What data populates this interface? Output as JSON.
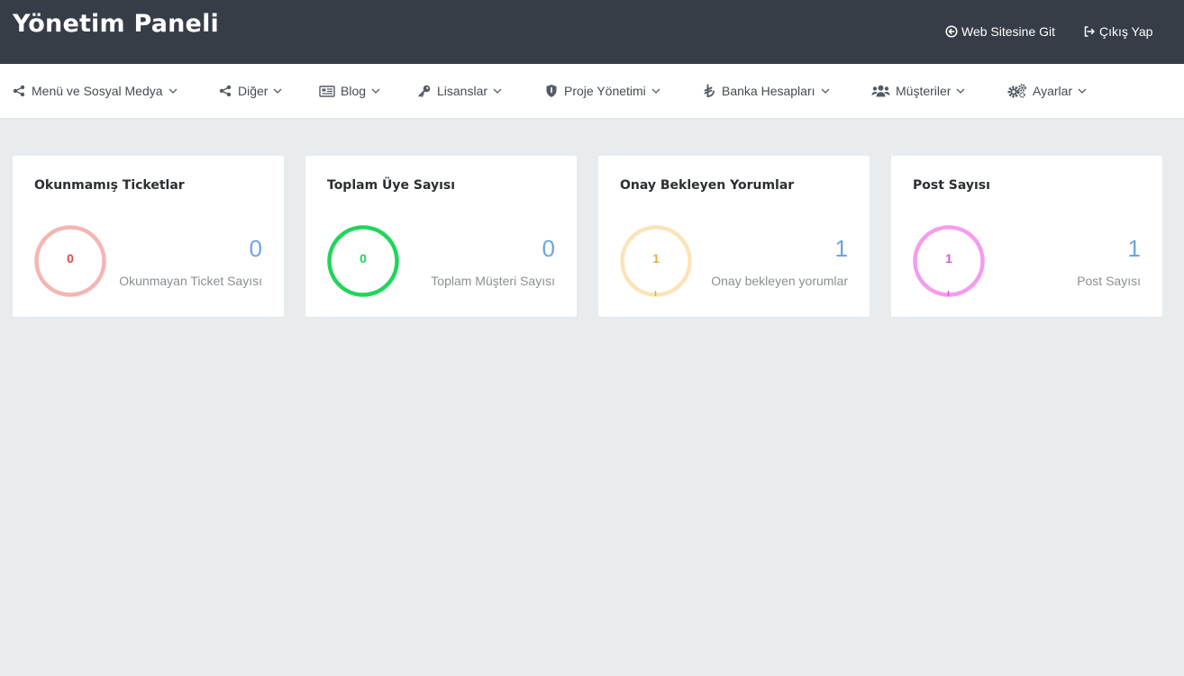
{
  "header": {
    "title": "Yönetim Paneli",
    "site_link": "Web Sitesine Git",
    "logout_link": "Çıkış Yap"
  },
  "nav": {
    "items": [
      {
        "label": "Menü ve Sosyal Medya",
        "icon": "share-icon"
      },
      {
        "label": "Diğer",
        "icon": "share-icon"
      },
      {
        "label": "Blog",
        "icon": "newspaper-icon"
      },
      {
        "label": "Lisanslar",
        "icon": "key-icon"
      },
      {
        "label": "Proje Yönetimi",
        "icon": "shield-icon"
      },
      {
        "label": "Banka Hesapları",
        "icon": "lira-icon"
      },
      {
        "label": "Müşteriler",
        "icon": "users-icon"
      },
      {
        "label": "Ayarlar",
        "icon": "cogs-icon"
      }
    ]
  },
  "cards": [
    {
      "title": "Okunmamış Ticketlar",
      "ring_value": "0",
      "value": "0",
      "subtitle": "Okunmayan Ticket Sayısı",
      "ring_color": "#f5b5b3",
      "num_color": "#e04848"
    },
    {
      "title": "Toplam Üye Sayısı",
      "ring_value": "0",
      "value": "0",
      "subtitle": "Toplam Müşteri Sayısı",
      "ring_color": "#1fd65a",
      "num_color": "#1fd65a"
    },
    {
      "title": "Onay Bekleyen Yorumlar",
      "ring_value": "1",
      "value": "1",
      "subtitle": "Onay bekleyen yorumlar",
      "ring_color": "#fde3b9",
      "num_color": "#f2a93b"
    },
    {
      "title": "Post Sayısı",
      "ring_value": "1",
      "value": "1",
      "subtitle": "Post Sayısı",
      "ring_color": "#f59cef",
      "num_color": "#e055d6"
    }
  ]
}
